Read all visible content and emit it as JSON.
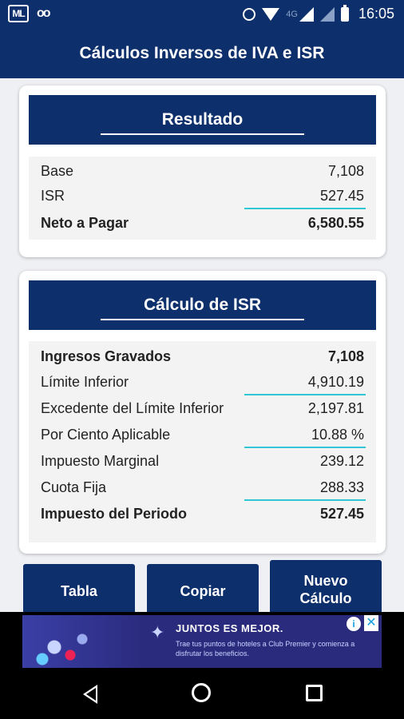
{
  "status": {
    "time": "16:05",
    "network": "4G",
    "logo": "ML"
  },
  "app": {
    "title": "Cálculos Inversos de IVA e ISR"
  },
  "resultado": {
    "title": "Resultado",
    "rows": [
      {
        "label": "Base",
        "value": "7,108"
      },
      {
        "label": "ISR",
        "value": "527.45"
      },
      {
        "label": "Neto a Pagar",
        "value": "6,580.55"
      }
    ]
  },
  "calculo": {
    "title": "Cálculo de ISR",
    "rows": [
      {
        "label": "Ingresos Gravados",
        "value": "7,108"
      },
      {
        "label": "Límite Inferior",
        "value": "4,910.19"
      },
      {
        "label": "Excedente del Límite Inferior",
        "value": "2,197.81"
      },
      {
        "label": "Por Ciento Aplicable",
        "value": "10.88 %"
      },
      {
        "label": "Impuesto Marginal",
        "value": "239.12"
      },
      {
        "label": "Cuota Fija",
        "value": "288.33"
      },
      {
        "label": "Impuesto del Periodo",
        "value": "527.45"
      }
    ]
  },
  "buttons": {
    "tabla": "Tabla",
    "copiar": "Copiar",
    "nuevo": "Nuevo Cálculo"
  },
  "ad": {
    "title": "JUNTOS ES MEJOR.",
    "text": "Trae tus puntos de hoteles a Club Premier y comienza a disfrutar los beneficios.",
    "info": "i",
    "close": "✕"
  },
  "colors": {
    "primary": "#0d2f6b",
    "accent": "#2fc6d6"
  }
}
